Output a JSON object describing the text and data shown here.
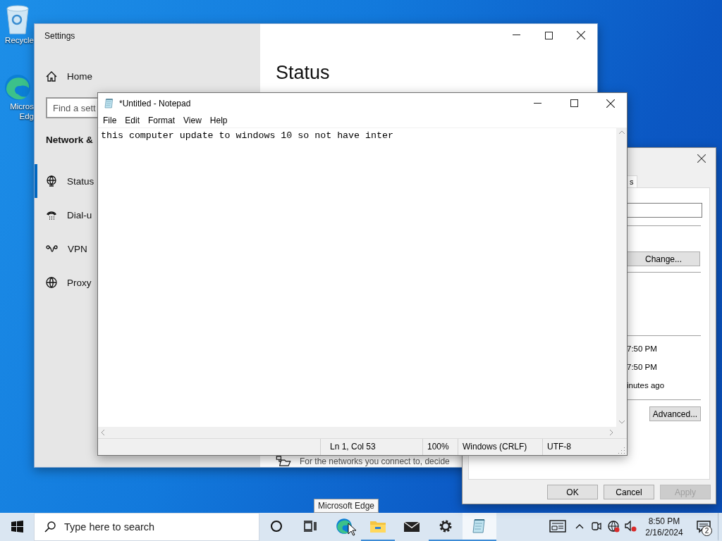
{
  "desktop_icons": [
    {
      "kind": "recycle",
      "lines": [
        "Recycle"
      ]
    },
    {
      "kind": "edge",
      "lines": [
        "Micros",
        "Edg"
      ]
    }
  ],
  "settings_window": {
    "title": "Settings",
    "home": "Home",
    "search": {
      "placeholder": "Find a sett"
    },
    "section": "Network &",
    "nav": [
      {
        "kind": "status",
        "label": "Status",
        "selected": true
      },
      {
        "kind": "dialup",
        "label": "Dial-u",
        "selected": false
      },
      {
        "kind": "vpn",
        "label": "VPN",
        "selected": false
      },
      {
        "kind": "proxy",
        "label": "Proxy",
        "selected": false
      }
    ],
    "heading": "Status",
    "footer_text": "For the networks you connect to, decide"
  },
  "properties_dialog": {
    "tab": {
      "label": "s",
      "selected": true
    },
    "change_button": "Change...",
    "rows": [
      "7:50 PM",
      "7:50 PM",
      "inutes ago"
    ],
    "advanced_button": "Advanced...",
    "buttons": [
      {
        "label": "OK",
        "disabled": false
      },
      {
        "label": "Cancel",
        "disabled": false
      },
      {
        "label": "Apply",
        "disabled": true
      }
    ]
  },
  "notepad": {
    "title": "*Untitled - Notepad",
    "menu": [
      "File",
      "Edit",
      "Format",
      "View",
      "Help"
    ],
    "text": "this computer update to windows 10 so not have inter",
    "status_bar": [
      "Ln 1, Col 53",
      "100%",
      "Windows (CRLF)",
      "UTF-8"
    ]
  },
  "tooltip": "Microsoft Edge",
  "taskbar": {
    "search_placeholder": "Type here to search",
    "apps": [
      {
        "kind": "cortana",
        "running": false,
        "active": false
      },
      {
        "kind": "taskview",
        "running": false,
        "active": false
      },
      {
        "kind": "edge",
        "running": false,
        "active": false
      },
      {
        "kind": "explorer",
        "running": true,
        "active": false
      },
      {
        "kind": "mail",
        "running": false,
        "active": false
      },
      {
        "kind": "settings",
        "running": true,
        "active": false
      },
      {
        "kind": "notepad",
        "running": true,
        "active": true
      }
    ],
    "clock": {
      "time": "8:50 PM",
      "date": "2/16/2024"
    },
    "notification_count": "2"
  }
}
